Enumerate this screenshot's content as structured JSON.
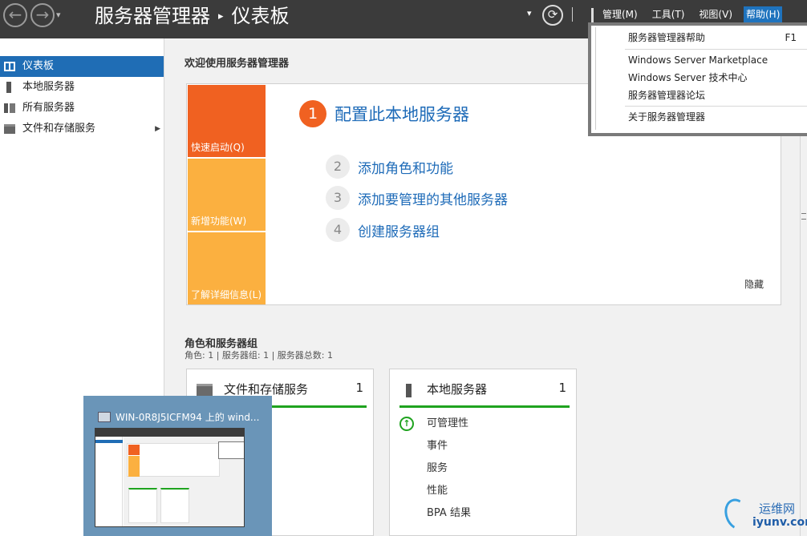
{
  "window": {
    "title": "服务器管理器",
    "breadcrumb_separator": "▸",
    "page": "仪表板",
    "back_icon": "back-arrow-icon",
    "forward_icon": "forward-arrow-icon",
    "refresh_icon": "refresh-icon"
  },
  "menu": [
    "管理(M)",
    "工具(T)",
    "视图(V)",
    "帮助(H)"
  ],
  "help_menu": {
    "items": [
      {
        "label": "服务器管理器帮助",
        "shortcut": "F1"
      },
      {
        "label": "Windows Server Marketplace",
        "shortcut": ""
      },
      {
        "label": "Windows Server 技术中心",
        "shortcut": ""
      },
      {
        "label": "服务器管理器论坛",
        "shortcut": ""
      },
      {
        "label": "关于服务器管理器",
        "shortcut": ""
      }
    ]
  },
  "sidebar": {
    "items": [
      {
        "label": "仪表板",
        "icon": "dashboard-icon",
        "selected": true
      },
      {
        "label": "本地服务器",
        "icon": "server-icon",
        "selected": false
      },
      {
        "label": "所有服务器",
        "icon": "servers-icon",
        "selected": false
      },
      {
        "label": "文件和存储服务",
        "icon": "file-storage-icon",
        "selected": false,
        "has_submenu": true
      }
    ]
  },
  "welcome": {
    "title": "欢迎使用服务器管理器",
    "tiles": [
      "快速启动(Q)",
      "新增功能(W)",
      "了解详细信息(L)"
    ],
    "steps": [
      {
        "num": "1",
        "label": "配置此本地服务器"
      },
      {
        "num": "2",
        "label": "添加角色和功能"
      },
      {
        "num": "3",
        "label": "添加要管理的其他服务器"
      },
      {
        "num": "4",
        "label": "创建服务器组"
      }
    ],
    "hide": "隐藏"
  },
  "roles": {
    "title": "角色和服务器组",
    "summary": "角色: 1 | 服务器组: 1 | 服务器总数: 1",
    "cards": [
      {
        "title": "文件和存储服务",
        "count": "1",
        "icon": "folder-icon",
        "rows": []
      },
      {
        "title": "本地服务器",
        "count": "1",
        "icon": "server-icon",
        "rows": [
          "可管理性",
          "事件",
          "服务",
          "性能",
          "BPA 结果"
        ]
      }
    ]
  },
  "thumbnail": {
    "title": "WIN-0R8J5ICFM94 上的 wind..."
  },
  "watermark": {
    "cn": "运维网",
    "en": "iyunv.com"
  },
  "colors": {
    "titlebar": "#3b3b3b",
    "selected": "#1f6db5",
    "quick_start": "#f06121",
    "tile_yellow": "#fbb040",
    "link": "#1e6bb8",
    "status_ok": "#1fa31f"
  }
}
